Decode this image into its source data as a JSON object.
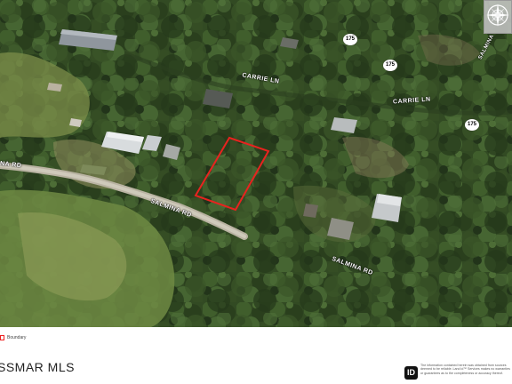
{
  "map": {
    "roads": [
      {
        "id": "salmina-rd-west",
        "label": "NA RD"
      },
      {
        "id": "salmina-rd-center",
        "label": "SALMINA RD"
      },
      {
        "id": "salmina-rd-south",
        "label": "SALMINA RD"
      },
      {
        "id": "carrie-ln-north",
        "label": "CARRIE LN"
      },
      {
        "id": "carrie-ln-east",
        "label": "CARRIE LN"
      },
      {
        "id": "unnamed-ne",
        "label": "SALMINA"
      }
    ],
    "route_shields": [
      {
        "id": "shield-1",
        "label": "175"
      },
      {
        "id": "shield-2",
        "label": "175"
      },
      {
        "id": "shield-3",
        "label": "175"
      }
    ],
    "boundary_color": "#e8231f",
    "compass_icon": "compass-rose-icon"
  },
  "legend": {
    "label": "Boundary",
    "swatch_color": "#e8231f"
  },
  "branding": {
    "mls_name": "SSMAR MLS",
    "idx_logo": "ID"
  },
  "disclaimer": "The information contained herein was obtained from sources deemed to be reliable. Land id™ Services makes no warranties or guarantees as to the completeness or accuracy thereof."
}
